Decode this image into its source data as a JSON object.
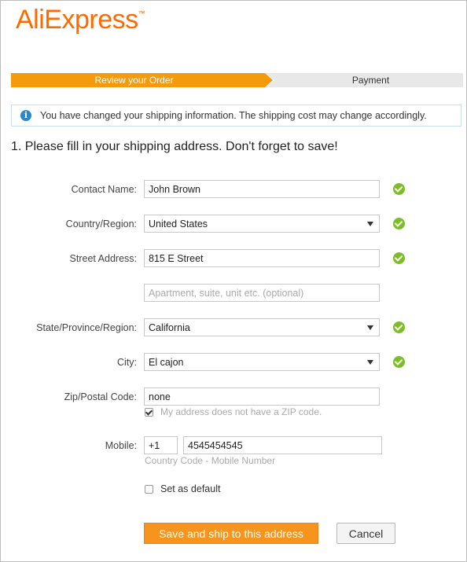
{
  "logo": {
    "ali": "Ali",
    "express": "Express",
    "tm": "™"
  },
  "steps": {
    "active": "Review your Order",
    "next": "Payment"
  },
  "notice": {
    "icon": "info-icon",
    "text": "You have changed your shipping information. The shipping cost may change accordingly."
  },
  "heading": "1. Please fill in your shipping address. Don't forget to save!",
  "form": {
    "contact_name": {
      "label": "Contact Name:",
      "value": "John Brown"
    },
    "country": {
      "label": "Country/Region:",
      "value": "United States"
    },
    "street": {
      "label": "Street Address:",
      "value": "815 E Street"
    },
    "apartment": {
      "placeholder": "Apartment, suite, unit etc. (optional)"
    },
    "state": {
      "label": "State/Province/Region:",
      "value": "California"
    },
    "city": {
      "label": "City:",
      "value": "El cajon"
    },
    "zip": {
      "label": "Zip/Postal Code:",
      "value": "none",
      "no_zip_checked": true,
      "no_zip_label": "My address does not have a ZIP code."
    },
    "mobile": {
      "label": "Mobile:",
      "country_code": "+1",
      "number": "4545454545",
      "hint": "Country Code - Mobile Number"
    },
    "default": {
      "checked": false,
      "label": "Set as default"
    }
  },
  "buttons": {
    "save": "Save and ship to this address",
    "cancel": "Cancel"
  },
  "colors": {
    "brand_orange": "#ff6a00",
    "step_active": "#f59a0a",
    "button_orange": "#f7941d",
    "valid_green": "#7bbf25",
    "info_blue": "#2a87d0"
  }
}
